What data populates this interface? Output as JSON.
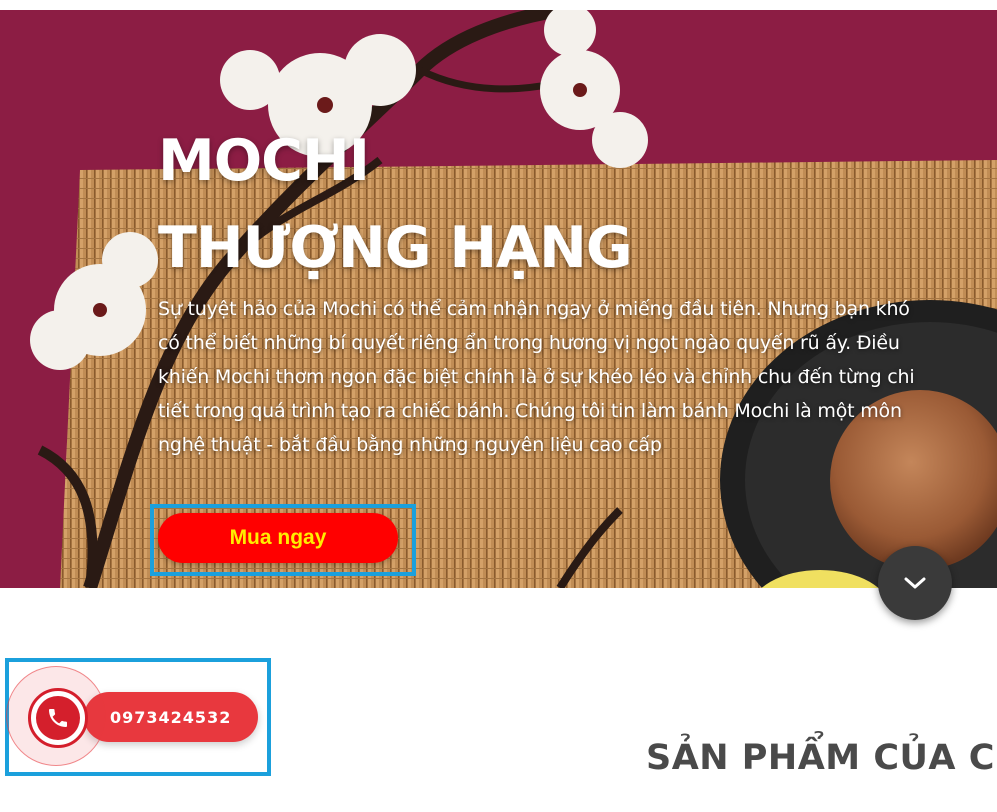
{
  "hero": {
    "title_line1": "MOCHI",
    "title_line2": "THƯỢNG HẠNG",
    "description": "Sự tuyệt hảo của Mochi có thể cảm nhận ngay ở miếng đầu tiên. Nhưng bạn khó có thể biết những bí quyết riêng ẩn trong hương vị ngọt ngào quyến rũ ấy. Điều khiến Mochi thơm ngon đặc biệt chính là ở sự khéo léo và chỉnh chu đến từng chi tiết trong quá trình tạo ra chiếc bánh. Chúng tôi tin làm bánh Mochi là một môn nghệ thuật - bắt đầu bằng những nguyên liệu cao cấp",
    "cta_label": "Mua ngay",
    "scroll_icon": "chevron-down-icon"
  },
  "hotline": {
    "phone": "0973424532",
    "icon": "phone-icon"
  },
  "products": {
    "heading": "SẢN PHẨM CỦA CH"
  },
  "colors": {
    "hero_bg": "#8c1d44",
    "cta_bg": "#ff0000",
    "cta_text": "#ffee00",
    "highlight_frame": "#1ba0dc",
    "hotline_red": "#e8383e"
  }
}
